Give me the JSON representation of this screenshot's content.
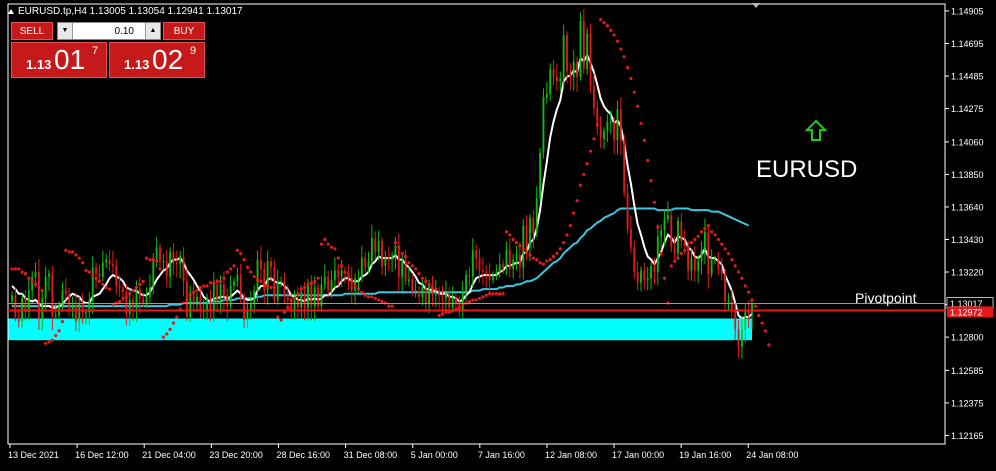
{
  "window": {
    "title": "EURUSD.tp,H4  1.13005 1.13054 1.12941 1.13017"
  },
  "trade_panel": {
    "sell_label": "SELL",
    "buy_label": "BUY",
    "lot_value": "0.10",
    "sell_price_prefix": "1.13",
    "sell_price_big": "01",
    "sell_price_sup": "7",
    "buy_price_prefix": "1.13",
    "buy_price_big": "02",
    "buy_price_sup": "9"
  },
  "annotations": {
    "symbol_label": "EURUSD",
    "pivot_label": "Pivotpoint",
    "symbol_color": "#ffffff",
    "arrow_color": "#1ec81e",
    "arrow_icon": "up-arrow-icon"
  },
  "price_labels": {
    "current_price": "1.13017",
    "pivot_price": "1.12972"
  },
  "chart_data": {
    "type": "candlestick",
    "y_ticks": [
      "1.14905",
      "1.14695",
      "1.14485",
      "1.14275",
      "1.14060",
      "1.13850",
      "1.13640",
      "1.13430",
      "1.13220",
      "1.13010",
      "1.12800",
      "1.12585",
      "1.12375",
      "1.12165"
    ],
    "ylim": [
      1.1211,
      1.1495
    ],
    "x_ticks": [
      "13 Dec 2021",
      "16 Dec 12:00",
      "21 Dec 04:00",
      "23 Dec 20:00",
      "28 Dec 16:00",
      "31 Dec 08:00",
      "5 Jan 00:00",
      "7 Jan 16:00",
      "12 Jan 08:00",
      "17 Jan 00:00",
      "19 Jan 16:00",
      "24 Jan 08:00"
    ],
    "current_price": 1.13017,
    "pivot_level": 1.12972,
    "support_zone": [
      1.1278,
      1.1292
    ],
    "colors": {
      "up": "#0bbf0b",
      "down": "#e41a1a",
      "fast_ma": "#ffffff",
      "slow_ma": "#38c8e0",
      "psar": "#e41a1a",
      "zone": "#00ffff",
      "pivot": "#e41a1a",
      "grid": "#ffffff"
    },
    "closes": [
      1.1307,
      1.1293,
      1.129,
      1.1305,
      1.1296,
      1.131,
      1.1319,
      1.1322,
      1.1292,
      1.1305,
      1.1319,
      1.1321,
      1.1294,
      1.1294,
      1.13,
      1.131,
      1.1308,
      1.1298,
      1.13,
      1.129,
      1.1302,
      1.1296,
      1.1296,
      1.1304,
      1.1325,
      1.1321,
      1.1319,
      1.1328,
      1.133,
      1.1327,
      1.1326,
      1.1313,
      1.1312,
      1.1309,
      1.1295,
      1.1304,
      1.1299,
      1.1311,
      1.1305,
      1.1302,
      1.1306,
      1.1312,
      1.133,
      1.1338,
      1.1329,
      1.1329,
      1.1319,
      1.1335,
      1.1328,
      1.1327,
      1.1332,
      1.1316,
      1.1293,
      1.1309,
      1.1301,
      1.1306,
      1.1297,
      1.1297,
      1.1305,
      1.1297,
      1.1314,
      1.1304,
      1.1314,
      1.1307,
      1.13,
      1.1313,
      1.1316,
      1.132,
      1.1306,
      1.1291,
      1.1297,
      1.1302,
      1.131,
      1.133,
      1.1324,
      1.131,
      1.1329,
      1.1325,
      1.1304,
      1.1316,
      1.1316,
      1.1306,
      1.1304,
      1.1297,
      1.1304,
      1.1299,
      1.1309,
      1.1299,
      1.1315,
      1.13,
      1.1312,
      1.13,
      1.1314,
      1.1319,
      1.131,
      1.1317,
      1.1323,
      1.1319,
      1.1323,
      1.1322,
      1.1318,
      1.131,
      1.1318,
      1.1318,
      1.1331,
      1.1325,
      1.1329,
      1.1344,
      1.1335,
      1.1342,
      1.1326,
      1.1331,
      1.133,
      1.1332,
      1.1339,
      1.1319,
      1.133,
      1.1316,
      1.1317,
      1.131,
      1.131,
      1.1306,
      1.1312,
      1.1302,
      1.1314,
      1.1307,
      1.1309,
      1.1307,
      1.1305,
      1.1308,
      1.1299,
      1.1306,
      1.1302,
      1.1297,
      1.1309,
      1.132,
      1.1319,
      1.1336,
      1.1331,
      1.1323,
      1.1322,
      1.1321,
      1.1317,
      1.132,
      1.1322,
      1.1327,
      1.1325,
      1.1336,
      1.1324,
      1.133,
      1.1333,
      1.1325,
      1.1352,
      1.1338,
      1.1357,
      1.1347,
      1.137,
      1.1399,
      1.1435,
      1.1437,
      1.1453,
      1.1448,
      1.1445,
      1.1447,
      1.1475,
      1.1452,
      1.1448,
      1.1458,
      1.1448,
      1.1484,
      1.1453,
      1.1476,
      1.1442,
      1.1428,
      1.1416,
      1.1408,
      1.1413,
      1.1419,
      1.1419,
      1.1407,
      1.1427,
      1.1407,
      1.1373,
      1.135,
      1.1338,
      1.1322,
      1.1315,
      1.1323,
      1.1317,
      1.1318,
      1.1326,
      1.1322,
      1.1345,
      1.1349,
      1.1356,
      1.1359,
      1.1338,
      1.1334,
      1.1355,
      1.1342,
      1.1339,
      1.1323,
      1.1331,
      1.1323,
      1.1329,
      1.1336,
      1.1348,
      1.1321,
      1.133,
      1.133,
      1.1324,
      1.1321,
      1.1303,
      1.1303,
      1.1298,
      1.1285,
      1.1274,
      1.1285,
      1.1297,
      1.1295,
      1.1302
    ],
    "series": [
      {
        "name": "",
        "kind": "fast_ma",
        "values": [
          1.1313,
          1.1311,
          1.1308,
          1.1308,
          1.1305,
          1.1304,
          1.1303,
          1.1304,
          1.1302,
          1.13,
          1.13,
          1.13,
          1.1299,
          1.1299,
          1.13,
          1.1301,
          1.1304,
          1.1306,
          1.1308,
          1.1307,
          1.1306,
          1.1303,
          1.1302,
          1.1302,
          1.1306,
          1.1307,
          1.1308,
          1.1311,
          1.1314,
          1.1318,
          1.132,
          1.1319,
          1.1318,
          1.1316,
          1.1312,
          1.1311,
          1.131,
          1.131,
          1.1308,
          1.1307,
          1.1307,
          1.1309,
          1.1313,
          1.1317,
          1.132,
          1.1323,
          1.1324,
          1.1328,
          1.133,
          1.133,
          1.1331,
          1.1328,
          1.1323,
          1.132,
          1.1317,
          1.1313,
          1.131,
          1.1306,
          1.1304,
          1.1303,
          1.1305,
          1.1305,
          1.1306,
          1.1306,
          1.1305,
          1.1306,
          1.1308,
          1.131,
          1.1308,
          1.1305,
          1.1304,
          1.1304,
          1.1305,
          1.131,
          1.1313,
          1.1313,
          1.1317,
          1.1318,
          1.1316,
          1.1315,
          1.1315,
          1.1313,
          1.1311,
          1.1307,
          1.1306,
          1.1304,
          1.1304,
          1.1303,
          1.1305,
          1.1304,
          1.1305,
          1.1304,
          1.1305,
          1.1307,
          1.1307,
          1.1309,
          1.1312,
          1.1313,
          1.1316,
          1.1318,
          1.1318,
          1.1316,
          1.1316,
          1.1316,
          1.1319,
          1.132,
          1.1322,
          1.1327,
          1.1329,
          1.1332,
          1.1331,
          1.1331,
          1.1331,
          1.1331,
          1.1333,
          1.133,
          1.133,
          1.1327,
          1.1325,
          1.1322,
          1.1319,
          1.1315,
          1.1314,
          1.1311,
          1.1311,
          1.131,
          1.131,
          1.1308,
          1.1308,
          1.1308,
          1.1306,
          1.1306,
          1.1305,
          1.1303,
          1.1304,
          1.1307,
          1.1309,
          1.1314,
          1.1318,
          1.1319,
          1.132,
          1.132,
          1.132,
          1.132,
          1.132,
          1.1322,
          1.1323,
          1.1326,
          1.1326,
          1.1327,
          1.1328,
          1.1328,
          1.1334,
          1.1335,
          1.1341,
          1.1343,
          1.135,
          1.1362,
          1.1379,
          1.1393,
          1.1409,
          1.1419,
          1.1427,
          1.1433,
          1.1445,
          1.1448,
          1.1449,
          1.1452,
          1.1451,
          1.146,
          1.1458,
          1.1462,
          1.1457,
          1.1451,
          1.1443,
          1.1434,
          1.1429,
          1.1426,
          1.1424,
          1.1418,
          1.142,
          1.1416,
          1.1405,
          1.1391,
          1.1379,
          1.1365,
          1.1353,
          1.1346,
          1.1338,
          1.1332,
          1.133,
          1.1327,
          1.1331,
          1.1335,
          1.1341,
          1.1346,
          1.1344,
          1.1341,
          1.1345,
          1.1344,
          1.1343,
          1.1338,
          1.1336,
          1.1332,
          1.1331,
          1.1333,
          1.1337,
          1.1332,
          1.1331,
          1.1331,
          1.1329,
          1.1327,
          1.132,
          1.1315,
          1.131,
          1.1302,
          1.1294,
          1.1292,
          1.1293,
          1.1293,
          1.1295
        ]
      },
      {
        "name": "",
        "kind": "slow_ma",
        "values": [
          1.13,
          1.13,
          1.13,
          1.13,
          1.13,
          1.13,
          1.13,
          1.13,
          1.13,
          1.13,
          1.13,
          1.13,
          1.13,
          1.13,
          1.13,
          1.13,
          1.13,
          1.13,
          1.13,
          1.13,
          1.13,
          1.13,
          1.13,
          1.13,
          1.13,
          1.13,
          1.13,
          1.13,
          1.13,
          1.13,
          1.13,
          1.13,
          1.13,
          1.13,
          1.13,
          1.13,
          1.13,
          1.13,
          1.13,
          1.13,
          1.13,
          1.13,
          1.13,
          1.13,
          1.13,
          1.13,
          1.13,
          1.1301,
          1.1301,
          1.1301,
          1.1301,
          1.1302,
          1.1302,
          1.1302,
          1.1302,
          1.1302,
          1.1302,
          1.1302,
          1.1302,
          1.1303,
          1.1303,
          1.1303,
          1.1303,
          1.1304,
          1.1304,
          1.1304,
          1.1304,
          1.1305,
          1.1305,
          1.1305,
          1.1305,
          1.1305,
          1.1305,
          1.1306,
          1.1306,
          1.1307,
          1.1307,
          1.1307,
          1.1307,
          1.1307,
          1.1307,
          1.1307,
          1.1307,
          1.1307,
          1.1307,
          1.1307,
          1.1307,
          1.1307,
          1.1307,
          1.1307,
          1.1307,
          1.1307,
          1.1307,
          1.1307,
          1.1307,
          1.1307,
          1.1307,
          1.1307,
          1.1307,
          1.1308,
          1.1308,
          1.1308,
          1.1308,
          1.1308,
          1.1308,
          1.1308,
          1.1308,
          1.1308,
          1.1308,
          1.1309,
          1.1309,
          1.1309,
          1.1309,
          1.1309,
          1.1309,
          1.1309,
          1.1309,
          1.1309,
          1.1309,
          1.1309,
          1.1309,
          1.1309,
          1.1309,
          1.1309,
          1.1309,
          1.1309,
          1.1309,
          1.1309,
          1.1309,
          1.1309,
          1.1309,
          1.1309,
          1.1309,
          1.1309,
          1.1309,
          1.1309,
          1.1309,
          1.131,
          1.131,
          1.131,
          1.1311,
          1.1311,
          1.1311,
          1.1311,
          1.1311,
          1.1312,
          1.1312,
          1.1313,
          1.1313,
          1.1313,
          1.1314,
          1.1314,
          1.1315,
          1.1316,
          1.1316,
          1.1317,
          1.1318,
          1.132,
          1.1322,
          1.1324,
          1.1326,
          1.1328,
          1.1329,
          1.1331,
          1.1334,
          1.1336,
          1.1338,
          1.134,
          1.1341,
          1.1344,
          1.1346,
          1.1349,
          1.135,
          1.1352,
          1.1354,
          1.1355,
          1.1357,
          1.1358,
          1.1359,
          1.136,
          1.1362,
          1.1363,
          1.1363,
          1.1363,
          1.1363,
          1.1363,
          1.1363,
          1.1363,
          1.1363,
          1.1363,
          1.1363,
          1.1363,
          1.1362,
          1.1362,
          1.1362,
          1.1362,
          1.1362,
          1.1363,
          1.1363,
          1.1363,
          1.1363,
          1.1363,
          1.1362,
          1.1362,
          1.1362,
          1.1362,
          1.1362,
          1.1362,
          1.1361,
          1.1361,
          1.1361,
          1.136,
          1.1359,
          1.1358,
          1.1357,
          1.1356,
          1.1355,
          1.1354,
          1.1353,
          1.1352
        ]
      },
      {
        "name": "",
        "kind": "psar",
        "values": [
          1.1324,
          1.1324,
          1.1324,
          1.1322,
          1.1321,
          1.1318,
          1.1316,
          1.1314,
          1.1312,
          1.131,
          1.1276,
          1.1277,
          1.1278,
          1.1281,
          1.1284,
          1.129,
          1.1336,
          1.1335,
          1.1335,
          1.1333,
          1.1331,
          1.1328,
          1.1323,
          1.1322,
          1.132,
          1.1318,
          1.1316,
          1.1314,
          1.1312,
          1.1311,
          1.1301,
          1.1302,
          1.1303,
          1.1305,
          1.1306,
          1.1308,
          1.131,
          1.1312,
          1.1314,
          1.1316,
          1.1331,
          1.133,
          1.133,
          1.1329,
          1.1324,
          1.128,
          1.1282,
          1.1285,
          1.1289,
          1.1293,
          1.1298,
          1.1302,
          1.1304,
          1.1307,
          1.1309,
          1.131,
          1.1312,
          1.1313,
          1.1313,
          1.1315,
          1.1315,
          1.1316,
          1.1316,
          1.1318,
          1.1322,
          1.1324,
          1.1326,
          1.1336,
          1.1334,
          1.133,
          1.1325,
          1.1322,
          1.1319,
          1.1317,
          1.1316,
          1.1314,
          1.1313,
          1.1312,
          1.1312,
          1.1293,
          1.1291,
          1.1296,
          1.1299,
          1.1304,
          1.1305,
          1.1308,
          1.1311,
          1.1312,
          1.1314,
          1.1315,
          1.1316,
          1.1318,
          1.134,
          1.1343,
          1.134,
          1.1338,
          1.1337,
          1.1331,
          1.1326,
          1.1322,
          1.1319,
          1.1316,
          1.1313,
          1.1311,
          1.1309,
          1.1307,
          1.1306,
          1.1306,
          1.1305,
          1.1304,
          1.1303,
          1.1302,
          1.13,
          1.13,
          1.1341,
          1.1338,
          1.1334,
          1.1332,
          1.1328,
          1.1326,
          1.1324,
          1.1321,
          1.1318,
          1.1316,
          1.1314,
          1.1312,
          1.1311,
          1.1294,
          1.1295,
          1.1296,
          1.1296,
          1.1297,
          1.1298,
          1.1299,
          1.1301,
          1.1302,
          1.1303,
          1.1304,
          1.1304,
          1.1305,
          1.1306,
          1.1307,
          1.1308,
          1.1308,
          1.1308,
          1.1308,
          1.1308,
          1.1348,
          1.1346,
          1.1343,
          1.1341,
          1.1339,
          1.1337,
          1.1335,
          1.1333,
          1.1331,
          1.133,
          1.1328,
          1.1327,
          1.1329,
          1.133,
          1.1332,
          1.1334,
          1.1337,
          1.1341,
          1.1346,
          1.1352,
          1.136,
          1.1368,
          1.1378,
          1.1385,
          1.1392,
          1.14,
          1.1408,
          1.1417,
          1.1485,
          1.1483,
          1.1481,
          1.1478,
          1.1475,
          1.1471,
          1.1466,
          1.1461,
          1.1454,
          1.1447,
          1.1438,
          1.1429,
          1.1418,
          1.1407,
          1.1394,
          1.1381,
          1.1367,
          1.1351,
          1.1334,
          1.1318,
          1.1302,
          1.1326,
          1.1329,
          1.1331,
          1.1334,
          1.1336,
          1.1338,
          1.1341,
          1.1343,
          1.1345,
          1.1348,
          1.135,
          1.1352,
          1.1348,
          1.1346,
          1.1343,
          1.134,
          1.1337,
          1.1334,
          1.133,
          1.1326,
          1.1322,
          1.1318,
          1.1313,
          1.1309,
          1.1304,
          1.13,
          1.1294,
          1.1289,
          1.1284,
          1.1275
        ]
      }
    ]
  }
}
